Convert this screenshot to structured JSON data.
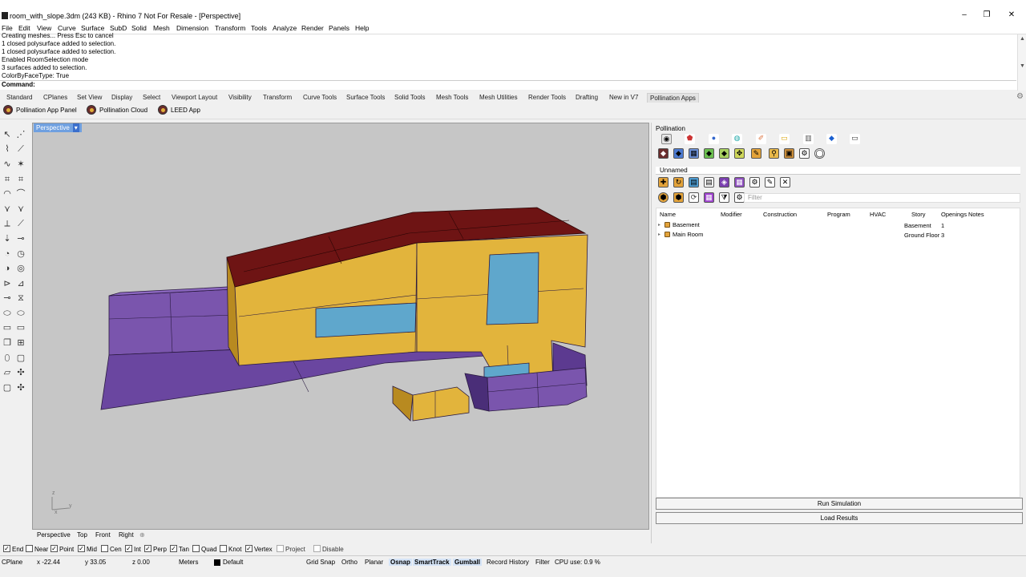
{
  "window": {
    "title": "room_with_slope.3dm (243 KB) - Rhino 7 Not For Resale - [Perspective]",
    "minimize": "–",
    "restore": "❐",
    "close": "✕"
  },
  "menu": [
    "File",
    "Edit",
    "View",
    "Curve",
    "Surface",
    "SubD",
    "Solid",
    "Mesh",
    "Dimension",
    "Transform",
    "Tools",
    "Analyze",
    "Render",
    "Panels",
    "Help"
  ],
  "command_history": [
    "Creating meshes... Press Esc to cancel",
    "1 closed polysurface added to selection.",
    "1 closed polysurface added to selection.",
    "Enabled RoomSelection mode",
    "3 surfaces added to selection.",
    "ColorByFaceType: True"
  ],
  "command_prompt": "Command:",
  "toolbar_tabs": [
    "Standard",
    "CPlanes",
    "Set View",
    "Display",
    "Select",
    "Viewport Layout",
    "Visibility",
    "Transform",
    "Curve Tools",
    "Surface Tools",
    "Solid Tools",
    "Mesh Tools",
    "Mesh Utilities",
    "Render Tools",
    "Drafting",
    "New in V7",
    "Pollination Apps"
  ],
  "active_toolbar_tab": "Pollination Apps",
  "pollination_buttons": [
    "Pollination App Panel",
    "Pollination Cloud",
    "LEED App"
  ],
  "viewport": {
    "name": "Perspective",
    "axis_z": "z",
    "axis_y": "y",
    "axis_x": "x",
    "colors": {
      "wall": "#e2b43c",
      "roof": "#6e1414",
      "window": "#5fa7cc",
      "adiabatic": "#7a55ad",
      "background": "#c6c6c6"
    }
  },
  "view_tabs": [
    "Perspective",
    "Top",
    "Front",
    "Right"
  ],
  "view_tabs_add": "⊕",
  "osnaps": [
    {
      "label": "End",
      "checked": true
    },
    {
      "label": "Near",
      "checked": false
    },
    {
      "label": "Point",
      "checked": true
    },
    {
      "label": "Mid",
      "checked": true
    },
    {
      "label": "Cen",
      "checked": false
    },
    {
      "label": "Int",
      "checked": true
    },
    {
      "label": "Perp",
      "checked": true
    },
    {
      "label": "Tan",
      "checked": true
    },
    {
      "label": "Quad",
      "checked": false
    },
    {
      "label": "Knot",
      "checked": false
    },
    {
      "label": "Vertex",
      "checked": true
    },
    {
      "label": "Project",
      "checked": false
    },
    {
      "label": "Disable",
      "checked": false
    }
  ],
  "status": {
    "cplane": "CPlane",
    "x": "x -22.44",
    "y": "y 33.05",
    "z": "z 0.00",
    "units": "Meters",
    "layer": "Default",
    "grid_snap": "Grid Snap",
    "ortho": "Ortho",
    "planar": "Planar",
    "osnap": "Osnap",
    "smarttrack": "SmartTrack",
    "gumball": "Gumball",
    "record_history": "Record History",
    "filter": "Filter",
    "cpu": "CPU use: 0.9 %"
  },
  "panel": {
    "title": "Pollination",
    "model_name": "Unnamed",
    "filter_placeholder": "Filter",
    "columns": [
      "Name",
      "Modifier",
      "Construction",
      "Program",
      "HVAC",
      "Story",
      "Openings",
      "Notes"
    ],
    "rows": [
      {
        "name": "Basement",
        "story": "Basement",
        "openings": "1"
      },
      {
        "name": "Main Room",
        "story": "Ground Floor",
        "openings": "3"
      }
    ],
    "run_simulation": "Run Simulation",
    "load_results": "Load Results"
  }
}
